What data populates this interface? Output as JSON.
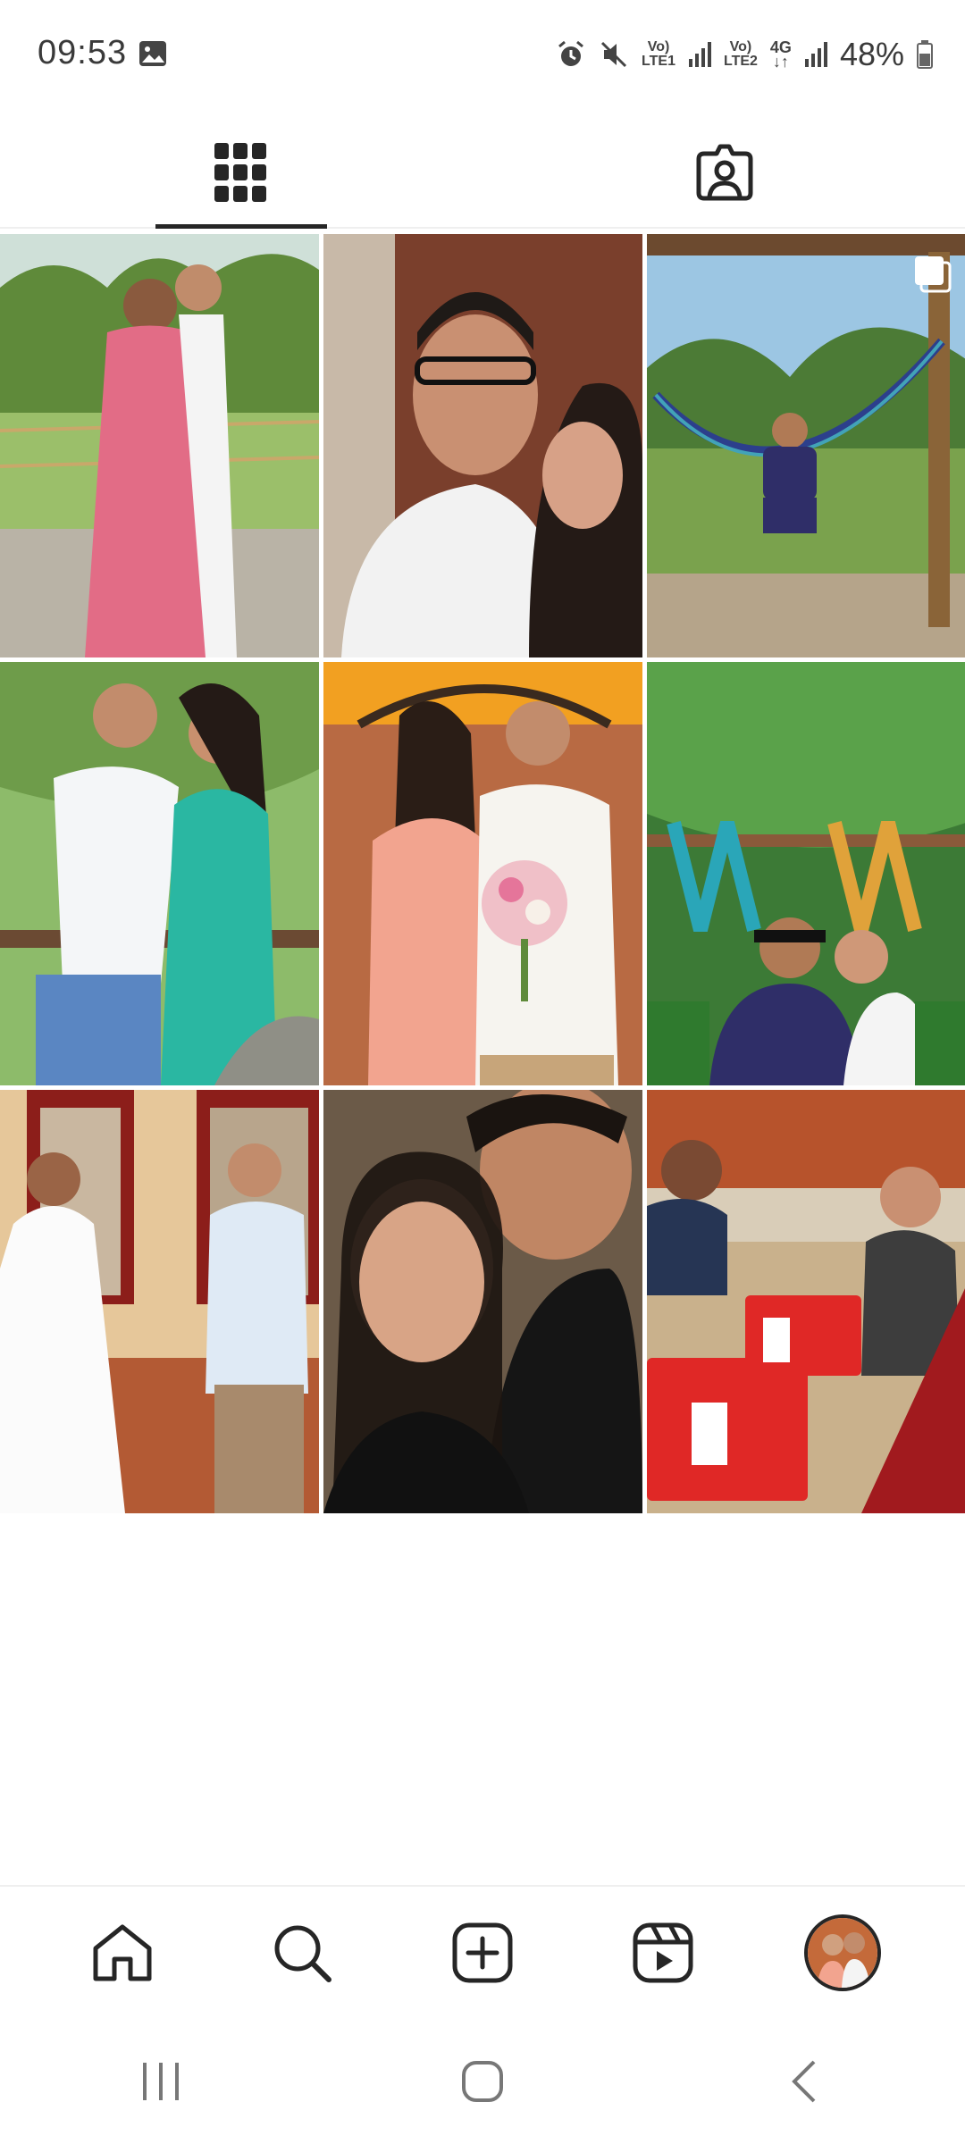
{
  "status_bar": {
    "time": "09:53",
    "sim1_top": "Vo)",
    "sim1_bottom": "LTE1",
    "sim2_top": "Vo)",
    "sim2_bottom": "LTE2",
    "network_type": "4G",
    "battery_percent": "48%",
    "icons": [
      "image-notification-icon",
      "alarm-icon",
      "mute-icon",
      "signal-icon",
      "battery-icon"
    ]
  },
  "tabs": [
    {
      "name": "posts-grid",
      "icon": "grid-icon",
      "selected": true
    },
    {
      "name": "tagged",
      "icon": "tagged-person-icon",
      "selected": false
    }
  ],
  "posts": [
    {
      "description": "couple-formal-pink-dress"
    },
    {
      "description": "couple-selfie-glasses"
    },
    {
      "description": "man-in-hammock",
      "multiple": true
    },
    {
      "description": "couple-posing-green-dress"
    },
    {
      "description": "couple-with-bouquet"
    },
    {
      "description": "couple-selfie-garden"
    },
    {
      "description": "couple-holding-hands-white-dress"
    },
    {
      "description": "couple-close-selfie"
    },
    {
      "description": "group-at-restaurant"
    }
  ],
  "bottom_nav": [
    "home-icon",
    "search-icon",
    "create-icon",
    "reels-icon",
    "profile-avatar"
  ],
  "colors": {
    "text": "#262626",
    "divider": "#efefef",
    "background": "#ffffff"
  }
}
